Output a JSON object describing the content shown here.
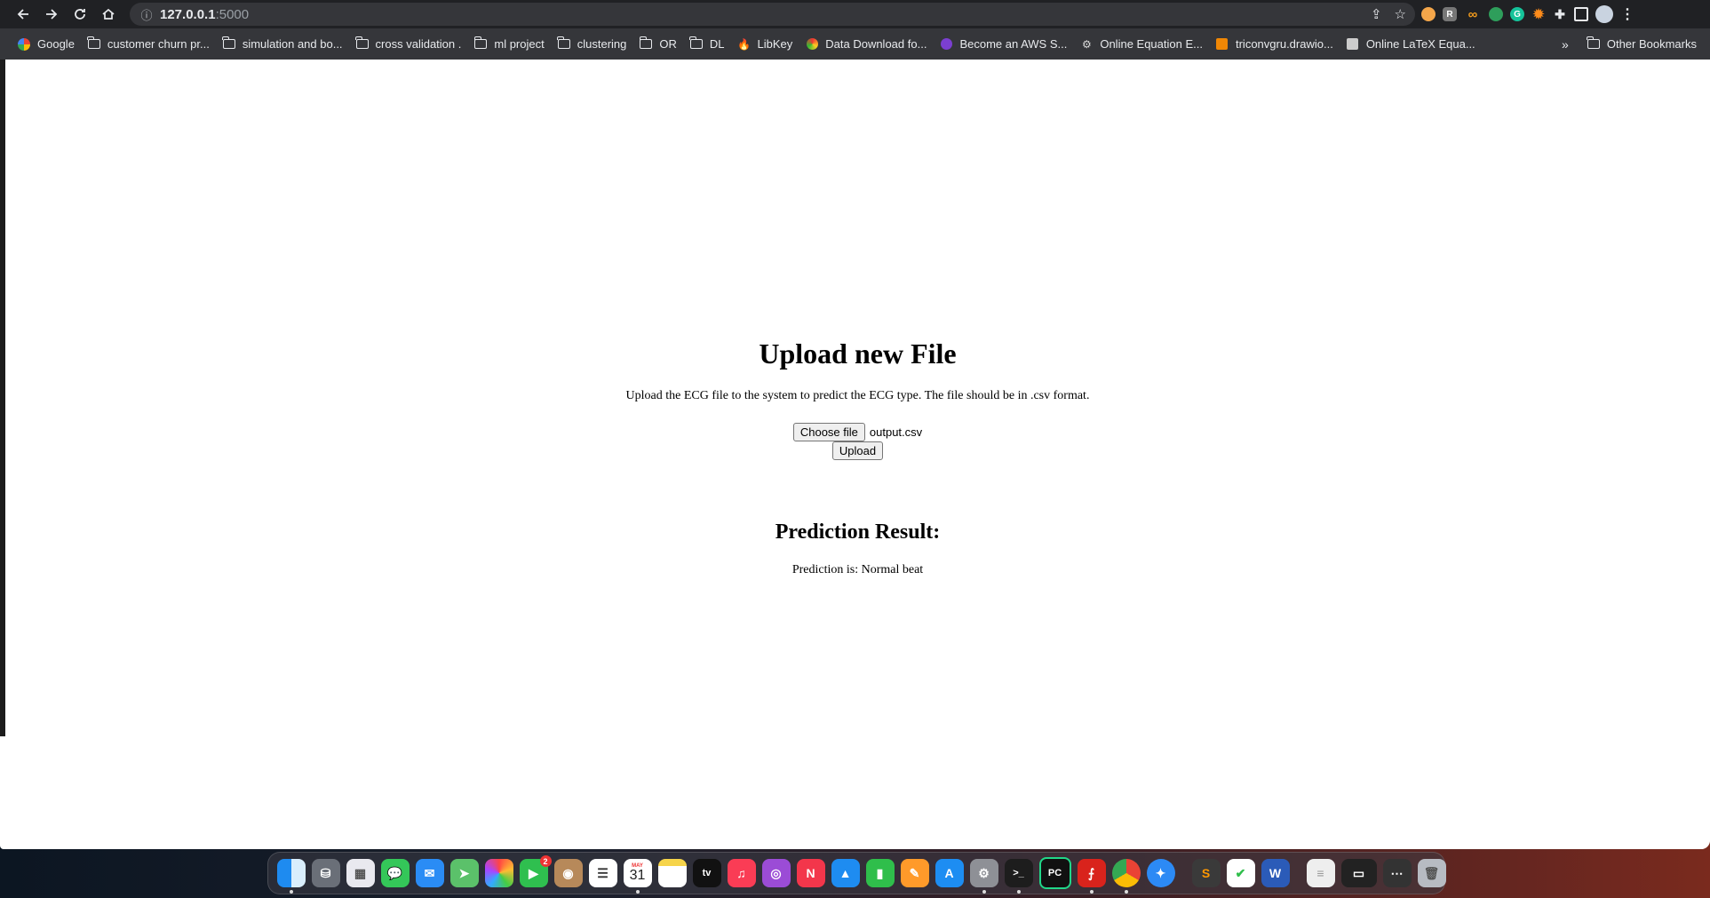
{
  "browser": {
    "url_host": "127.0.0.1",
    "url_port": ":5000",
    "bookmarks": [
      {
        "label": "Google",
        "icon": "google-icon"
      },
      {
        "label": "customer churn pr...",
        "icon": "folder-icon"
      },
      {
        "label": "simulation and bo...",
        "icon": "folder-icon"
      },
      {
        "label": "cross validation .",
        "icon": "folder-icon"
      },
      {
        "label": "ml project",
        "icon": "folder-icon"
      },
      {
        "label": "clustering",
        "icon": "folder-icon"
      },
      {
        "label": "OR",
        "icon": "folder-icon"
      },
      {
        "label": "DL",
        "icon": "folder-icon"
      },
      {
        "label": "LibKey",
        "icon": "flame-icon"
      },
      {
        "label": "Data Download fo...",
        "icon": "globe-icon"
      },
      {
        "label": "Become an AWS S...",
        "icon": "aws-icon"
      },
      {
        "label": "Online Equation E...",
        "icon": "gear-icon"
      },
      {
        "label": "triconvgru.drawio...",
        "icon": "drawio-icon"
      },
      {
        "label": "Online LaTeX Equa...",
        "icon": "latex-icon"
      }
    ],
    "more_bookmarks": "»",
    "other_bookmarks": "Other Bookmarks"
  },
  "page": {
    "title": "Upload new File",
    "description": "Upload the ECG file to the system to predict the ECG type. The file should be in .csv format.",
    "choose_file_label": "Choose file",
    "chosen_file": "output.csv",
    "upload_label": "Upload",
    "result_heading": "Prediction Result:",
    "result_text": "Prediction is: Normal beat"
  },
  "dock": {
    "calendar_month": "MAY",
    "calendar_day": "31",
    "facetime_badge": "2",
    "apple_tv_label": "tv",
    "pycharm_label": "PC",
    "word_label": "W"
  },
  "colors": {
    "toolbar_bg": "#202124",
    "bookmarks_bg": "#35363a",
    "page_bg": "#ffffff"
  }
}
